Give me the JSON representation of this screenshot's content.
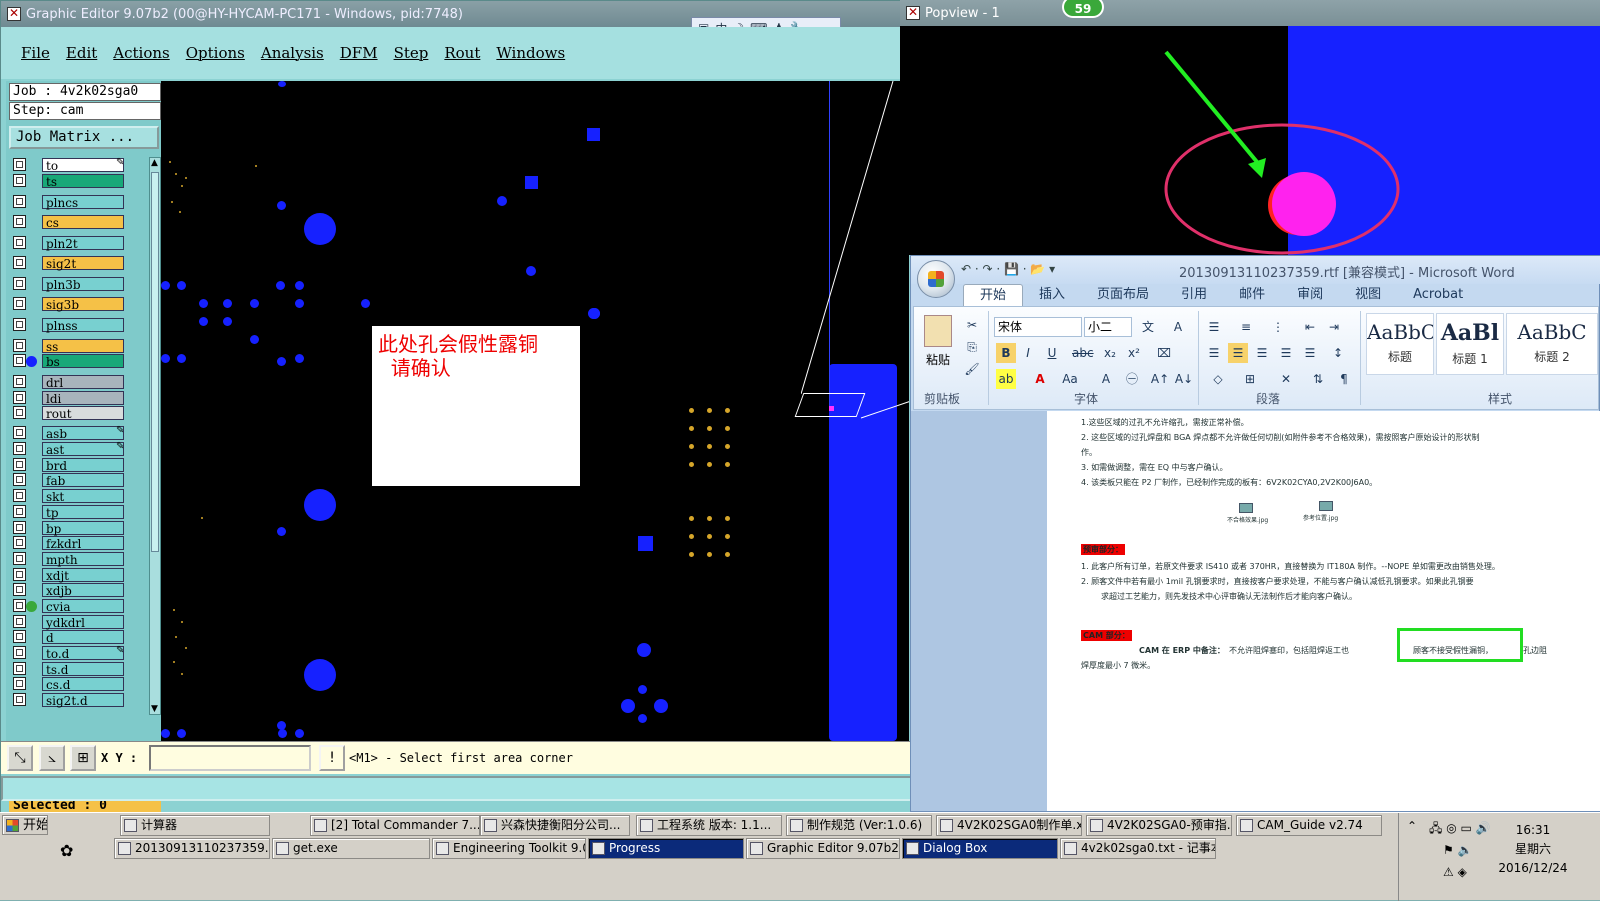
{
  "graphic_editor": {
    "title": "Graphic Editor 9.07b2 (00@HY-HYCAM-PC171 - Windows, pid:7748)",
    "ime_bar": [
      "中",
      "☽",
      "⌨",
      "♟",
      "🔧"
    ],
    "menu": [
      "File",
      "Edit",
      "Actions",
      "Options",
      "Analysis",
      "DFM",
      "Step",
      "Rout",
      "Windows"
    ],
    "job_line": "Job : 4v2k02sga0",
    "step_line": "Step: cam",
    "job_matrix_label": "Job Matrix ...",
    "selected_label": "Selected : 0",
    "layers": [
      {
        "name": "to",
        "color": "#ffffff",
        "pen": true
      },
      {
        "name": "ts",
        "color": "#18a878",
        "pen": false
      },
      {
        "name": "plncs",
        "color": "#78d0d0",
        "pen": false
      },
      {
        "name": "cs",
        "color": "#f5c147",
        "pen": false
      },
      {
        "name": "pln2t",
        "color": "#78d0d0",
        "pen": false
      },
      {
        "name": "sig2t",
        "color": "#f5c147",
        "pen": false
      },
      {
        "name": "pln3b",
        "color": "#78d0d0",
        "pen": false
      },
      {
        "name": "sig3b",
        "color": "#f5c147",
        "pen": false
      },
      {
        "name": "plnss",
        "color": "#78d0d0",
        "pen": false
      },
      {
        "name": "ss",
        "color": "#f5c147",
        "pen": false
      },
      {
        "name": "bs",
        "color": "#18a878",
        "pen": false
      },
      {
        "name": "drl",
        "color": "#a8b4bc",
        "pen": false
      },
      {
        "name": "ldi",
        "color": "#a8b4bc",
        "pen": false
      },
      {
        "name": "rout",
        "color": "#d8dcdc",
        "pen": false
      },
      {
        "name": "asb",
        "color": "#78d0d0",
        "pen": true
      },
      {
        "name": "ast",
        "color": "#78d0d0",
        "pen": true
      },
      {
        "name": "brd",
        "color": "#78d0d0",
        "pen": false
      },
      {
        "name": "fab",
        "color": "#78d0d0",
        "pen": false
      },
      {
        "name": "skt",
        "color": "#78d0d0",
        "pen": false
      },
      {
        "name": "tp",
        "color": "#78d0d0",
        "pen": false
      },
      {
        "name": "bp",
        "color": "#78d0d0",
        "pen": false
      },
      {
        "name": "fzkdrl",
        "color": "#78d0d0",
        "pen": false
      },
      {
        "name": "mpth",
        "color": "#78d0d0",
        "pen": false
      },
      {
        "name": "xdjt",
        "color": "#78d0d0",
        "pen": false
      },
      {
        "name": "xdjb",
        "color": "#78d0d0",
        "pen": false
      },
      {
        "name": "cvia",
        "color": "#78d0d0",
        "pen": false
      },
      {
        "name": "ydkdrl",
        "color": "#78d0d0",
        "pen": false
      },
      {
        "name": "d",
        "color": "#78d0d0",
        "pen": false
      },
      {
        "name": "to.d",
        "color": "#78d0d0",
        "pen": true
      },
      {
        "name": "ts.d",
        "color": "#78d0d0",
        "pen": false
      },
      {
        "name": "cs.d",
        "color": "#78d0d0",
        "pen": false
      },
      {
        "name": "sig2t.d",
        "color": "#78d0d0",
        "pen": false
      }
    ],
    "note_text": "此处孔会假性露铜\n  请确认",
    "xy_label": "X Y :",
    "xy_value": "",
    "prompt": "<M1> - Select first area corner"
  },
  "popview": {
    "title": "Popview - 1",
    "badge": "59"
  },
  "word": {
    "title": "20130913110237359.rtf [兼容模式] - Microsoft Word",
    "title_visible": "20130913110237359.rtf [兼容模式] - Microsoft Word",
    "tabs": [
      "开始",
      "插入",
      "页面布局",
      "引用",
      "邮件",
      "审阅",
      "视图",
      "Acrobat"
    ],
    "active_tab": "开始",
    "clipboard_label": "剪贴板",
    "paste_label": "粘贴",
    "font_group_label": "字体",
    "paragraph_group_label": "段落",
    "styles_group_label": "样式",
    "font_name": "宋体",
    "font_size": "小二",
    "styles": [
      {
        "preview": "AaBbC",
        "name": "标题"
      },
      {
        "preview": "AaBl",
        "name": "标题 1"
      },
      {
        "preview": "AaBbC",
        "name": "标题 2"
      }
    ],
    "doc_lines": [
      "1.这些区域的过孔不允许缩孔，需按正常补偿。",
      "2. 这些区域的过孔焊盘和 BGA 焊点都不允许做任何切削(如附件参考不合格效果)，需按照客户原始设计的形状制",
      "作。",
      "3. 如需做调整，需在 EQ 中与客户确认。",
      "4. 该类板只能在 P2 厂制作，已经制作完成的板有：6V2K02CYA0,2V2K00J6A0。"
    ],
    "attach_labels": [
      "不合格效果.jpg",
      "参考位置.jpg"
    ],
    "review_heading": "预审部分：",
    "review_lines": [
      "1.    此客户所有订单，若原文件要求 IS410 或者 370HR，直接替换为 IT180A 制作。--NOPE 单如需更改由销售处理。",
      "2.    顾客文件中若有最小 1mil 孔钢要求时，直接按客户要求处理，不能与客户确认减低孔钢要求。如果此孔钢要",
      "求超过工艺能力，则先发技术中心评审确认无法制作后才能向客户确认。"
    ],
    "cam_heading": "CAM 部分：",
    "cam_line_1_bold": "CAM 在 ERP 中备注：",
    "cam_line_1": "不允许阻焊塞印，包括阻焊返工也",
    "cam_highlight": "顾客不接受假性漏铜，",
    "cam_line_1_tail": "孔边阻",
    "cam_line_2": "焊厚度最小 7 微米。"
  },
  "taskbar": {
    "start": "开始",
    "row1": [
      {
        "label": "计算器"
      },
      {
        "label": "[2] Total Commander 7..."
      },
      {
        "label": "兴森快捷衡阳分公司..."
      },
      {
        "label": "工程系统  版本: 1.1..."
      },
      {
        "label": "制作规范 (Ver:1.0.6)"
      },
      {
        "label": "4V2K02SGA0制作单.xl..."
      },
      {
        "label": "4V2K02SGA0-预审指..."
      },
      {
        "label": "CAM_Guide v2.74"
      }
    ],
    "row2": [
      {
        "label": "20130913110237359....",
        "active": false
      },
      {
        "label": "get.exe",
        "active": false
      },
      {
        "label": "Engineering Toolkit 9.07...",
        "active": false
      },
      {
        "label": "Progress",
        "active": true
      },
      {
        "label": "Graphic Editor 9.07b2 (0...",
        "active": false
      },
      {
        "label": "Dialog Box",
        "active": true
      },
      {
        "label": "4v2k02sga0.txt - 记事本",
        "active": false
      }
    ],
    "clock_time": "16:31",
    "clock_day": "星期六",
    "clock_date": "2016/12/24"
  }
}
